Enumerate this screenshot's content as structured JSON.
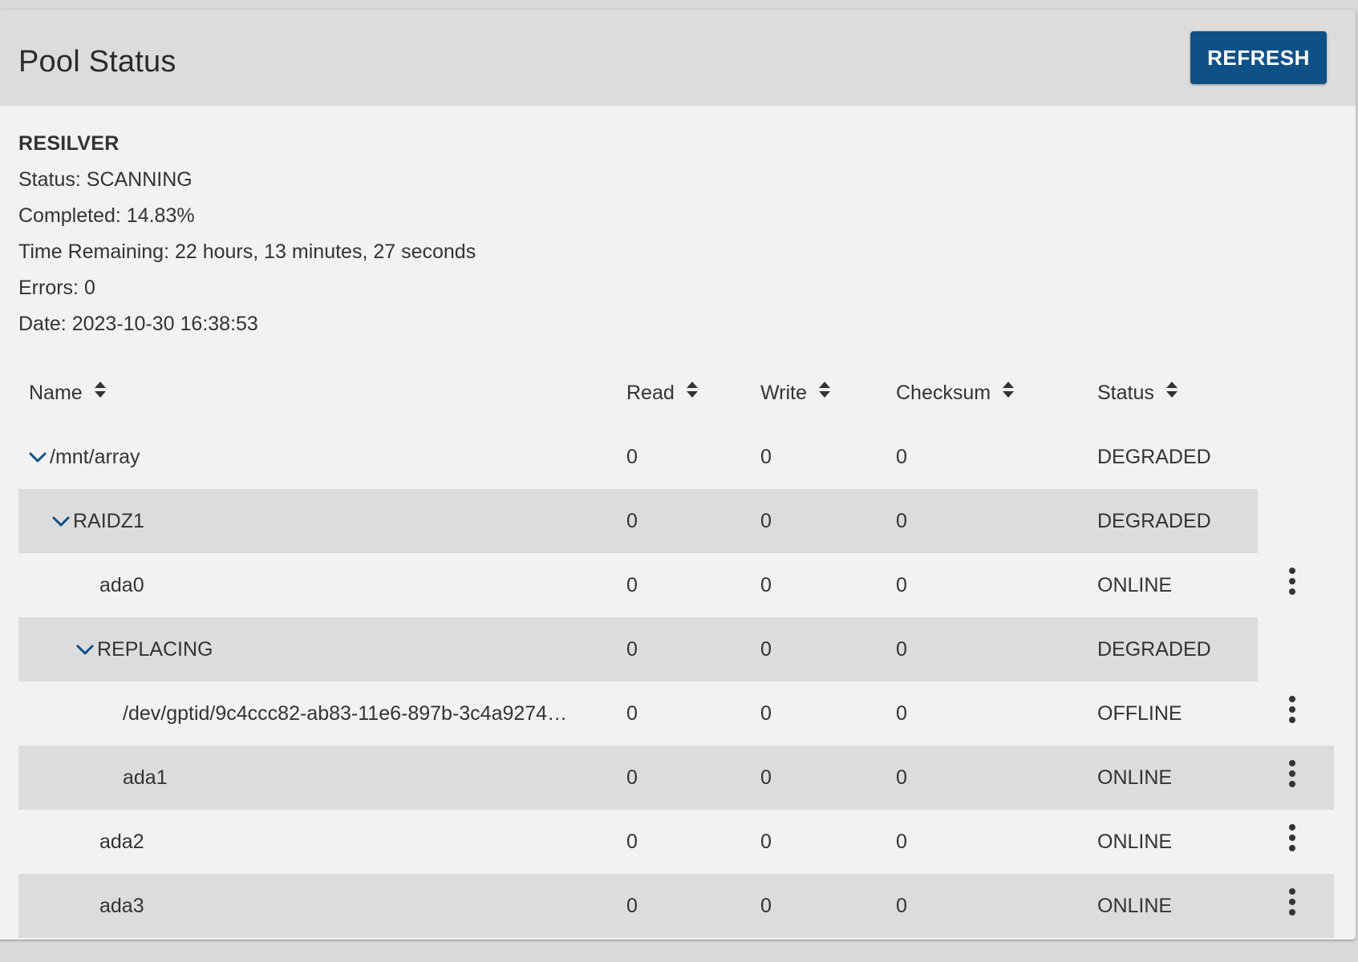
{
  "header": {
    "title": "Pool Status",
    "refresh_label": "REFRESH"
  },
  "colors": {
    "accent": "#0e5187",
    "header_bg": "#dcdcdc",
    "card_bg": "#f2f2f2",
    "row_shade": "#dcdcdc"
  },
  "scan": {
    "heading": "RESILVER",
    "status": "Status: SCANNING",
    "completed": "Completed: 14.83%",
    "time_remaining": "Time Remaining: 22 hours, 13 minutes, 27 seconds",
    "errors": "Errors: 0",
    "date": "Date: 2023-10-30 16:38:53"
  },
  "table": {
    "columns": {
      "name": "Name",
      "read": "Read",
      "write": "Write",
      "checksum": "Checksum",
      "status": "Status"
    },
    "rows": [
      {
        "name": "/mnt/array",
        "read": "0",
        "write": "0",
        "checksum": "0",
        "status": "DEGRADED",
        "expandable": true,
        "level": 0,
        "actions": false
      },
      {
        "name": "RAIDZ1",
        "read": "0",
        "write": "0",
        "checksum": "0",
        "status": "DEGRADED",
        "expandable": true,
        "level": 1,
        "actions": false
      },
      {
        "name": "ada0",
        "read": "0",
        "write": "0",
        "checksum": "0",
        "status": "ONLINE",
        "expandable": false,
        "level": 2,
        "actions": true
      },
      {
        "name": "REPLACING",
        "read": "0",
        "write": "0",
        "checksum": "0",
        "status": "DEGRADED",
        "expandable": true,
        "level": 2,
        "actions": false
      },
      {
        "name": "/dev/gptid/9c4ccc82-ab83-11e6-897b-3c4a9274…",
        "read": "0",
        "write": "0",
        "checksum": "0",
        "status": "OFFLINE",
        "expandable": false,
        "level": 3,
        "actions": true
      },
      {
        "name": "ada1",
        "read": "0",
        "write": "0",
        "checksum": "0",
        "status": "ONLINE",
        "expandable": false,
        "level": 3,
        "actions": true
      },
      {
        "name": "ada2",
        "read": "0",
        "write": "0",
        "checksum": "0",
        "status": "ONLINE",
        "expandable": false,
        "level": 2,
        "actions": true
      },
      {
        "name": "ada3",
        "read": "0",
        "write": "0",
        "checksum": "0",
        "status": "ONLINE",
        "expandable": false,
        "level": 2,
        "actions": true
      }
    ]
  },
  "icons": {
    "sort": "sort-icon",
    "expand": "chevron-down-icon",
    "actions": "more-vert-icon"
  }
}
